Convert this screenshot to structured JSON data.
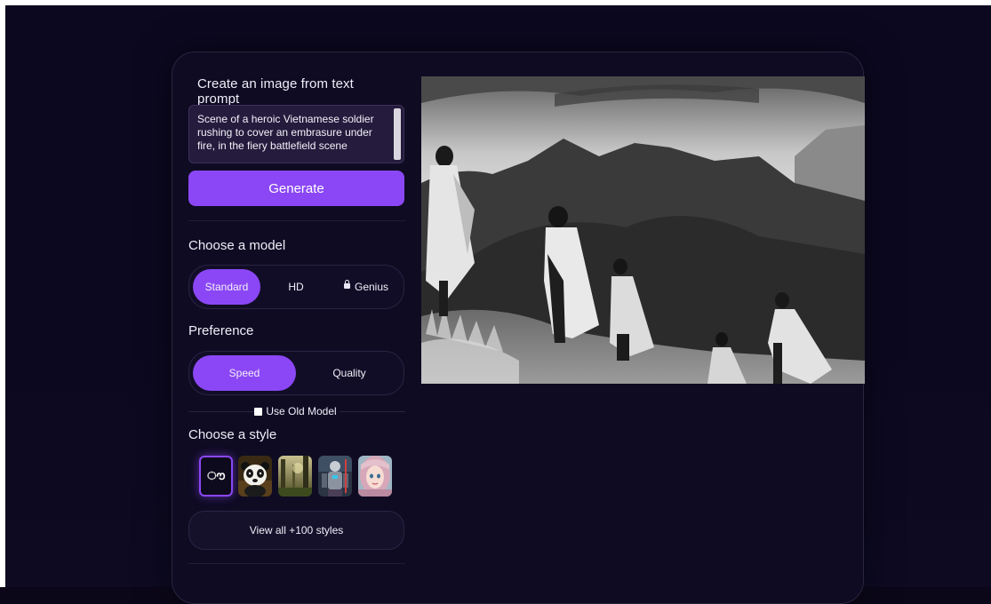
{
  "panel": {
    "title": "Create an image from text prompt",
    "prompt": "Scene of a heroic Vietnamese soldier rushing to cover an embrasure under fire, in the fiery battlefield scene",
    "generate_label": "Generate"
  },
  "model": {
    "label": "Choose a model",
    "options": [
      "Standard",
      "HD",
      "Genius"
    ],
    "selected": "Standard",
    "locked": [
      "Genius"
    ]
  },
  "preference": {
    "label": "Preference",
    "options": [
      "Speed",
      "Quality"
    ],
    "selected": "Speed"
  },
  "old_model": {
    "label": "Use Old Model",
    "checked": false
  },
  "style": {
    "label": "Choose a style",
    "default_glyph": "ൗ",
    "thumbnails": [
      "panda",
      "forest",
      "robot-warrior",
      "anime-girl"
    ],
    "view_all_label": "View all +100 styles"
  },
  "result": {
    "image": "black-and-white-soldiers-on-mountain"
  },
  "colors": {
    "accent": "#8b47f5",
    "background": "#0c0820",
    "card": "#0f0b23"
  }
}
